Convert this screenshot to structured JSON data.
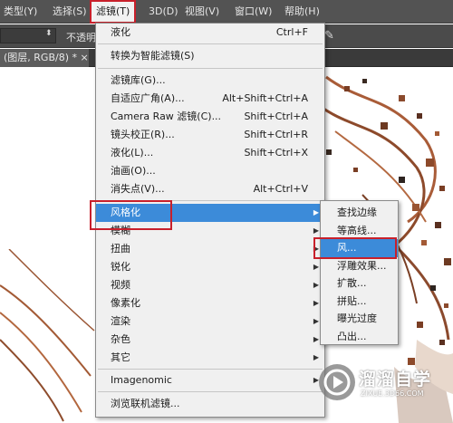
{
  "menubar": {
    "items": [
      "类型(Y)",
      "选择(S)",
      "滤镜(T)",
      "3D(D)",
      "视图(V)",
      "窗口(W)",
      "帮助(H)"
    ]
  },
  "options_bar": {
    "label": "不透明"
  },
  "document_tab": {
    "label": "(图层, RGB/8) * ×"
  },
  "filter_menu": {
    "items": [
      {
        "label": "液化",
        "shortcut": "Ctrl+F"
      },
      {
        "label": "转换为智能滤镜(S)",
        "shortcut": ""
      },
      {
        "label": "滤镜库(G)...",
        "shortcut": ""
      },
      {
        "label": "自适应广角(A)...",
        "shortcut": "Alt+Shift+Ctrl+A"
      },
      {
        "label": "Camera Raw 滤镜(C)...",
        "shortcut": "Shift+Ctrl+A"
      },
      {
        "label": "镜头校正(R)...",
        "shortcut": "Shift+Ctrl+R"
      },
      {
        "label": "液化(L)...",
        "shortcut": "Shift+Ctrl+X"
      },
      {
        "label": "油画(O)...",
        "shortcut": ""
      },
      {
        "label": "消失点(V)...",
        "shortcut": "Alt+Ctrl+V"
      },
      {
        "label": "风格化",
        "shortcut": ""
      },
      {
        "label": "模糊",
        "shortcut": ""
      },
      {
        "label": "扭曲",
        "shortcut": ""
      },
      {
        "label": "锐化",
        "shortcut": ""
      },
      {
        "label": "视频",
        "shortcut": ""
      },
      {
        "label": "像素化",
        "shortcut": ""
      },
      {
        "label": "渲染",
        "shortcut": ""
      },
      {
        "label": "杂色",
        "shortcut": ""
      },
      {
        "label": "其它",
        "shortcut": ""
      },
      {
        "label": "Imagenomic",
        "shortcut": ""
      },
      {
        "label": "浏览联机滤镜...",
        "shortcut": ""
      }
    ],
    "highlighted": "风格化"
  },
  "stylize_submenu": {
    "items": [
      "查找边缘",
      "等高线...",
      "风...",
      "浮雕效果...",
      "扩散...",
      "拼贴...",
      "曝光过度",
      "凸出..."
    ],
    "highlighted": "风..."
  },
  "watermark": {
    "title": "溜溜自学",
    "url": "ZIXUE.3D66.COM"
  },
  "colors": {
    "highlight": "#3c8bd9",
    "annotation_red": "#c8202b",
    "chrome_dark": "#535353"
  }
}
